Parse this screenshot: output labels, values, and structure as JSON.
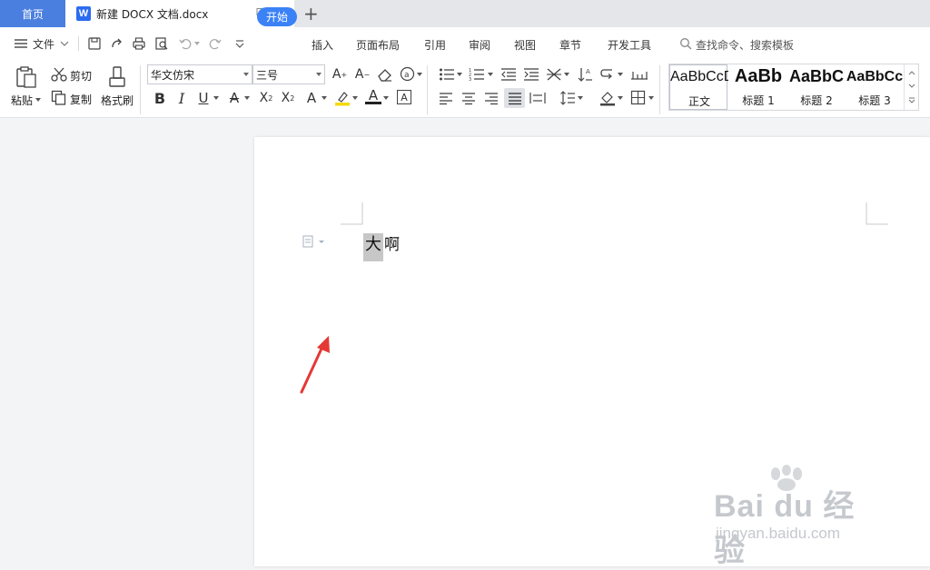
{
  "tabbar": {
    "home_label": "首页",
    "doc_title": "新建 DOCX 文档.docx",
    "add_tab": "+"
  },
  "menubar": {
    "file_label": "文件",
    "items": [
      "开始",
      "插入",
      "页面布局",
      "引用",
      "审阅",
      "视图",
      "章节",
      "开发工具"
    ],
    "active": "开始",
    "search_placeholder": "查找命令、搜索模板"
  },
  "ribbon": {
    "paste_label": "粘贴",
    "cut_label": "剪切",
    "copy_label": "复制",
    "format_painter_label": "格式刷",
    "font_name": "华文仿宋",
    "font_size": "三号",
    "styles": [
      {
        "preview": "AaBbCcDd",
        "name": "正文"
      },
      {
        "preview": "AaBb",
        "name": "标题 1"
      },
      {
        "preview": "AaBbC",
        "name": "标题 2"
      },
      {
        "preview": "AaBbCc",
        "name": "标题 3"
      }
    ]
  },
  "document": {
    "selected_char": "大",
    "rest_text": "啊"
  },
  "watermark": {
    "brand": "Bai du 经验",
    "url": "jingyan.baidu.com"
  },
  "colors": {
    "accent": "#3b82f6",
    "home_tab": "#4a7fe0",
    "arrow": "#e53935",
    "unsaved_dot": "#f5a623"
  }
}
